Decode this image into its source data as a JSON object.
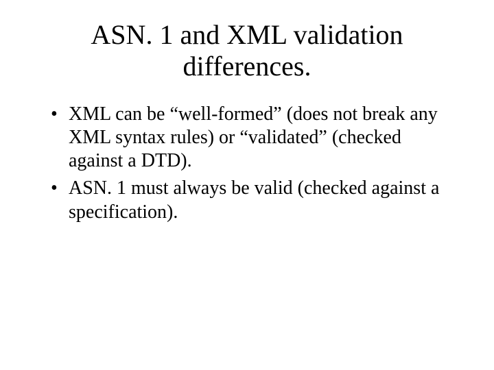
{
  "slide": {
    "title": "ASN. 1 and XML validation differences.",
    "bullets": [
      "XML can be “well-formed” (does not break any XML syntax rules) or “validated” (checked against a DTD).",
      "ASN. 1 must always be valid (checked against a specification)."
    ]
  }
}
